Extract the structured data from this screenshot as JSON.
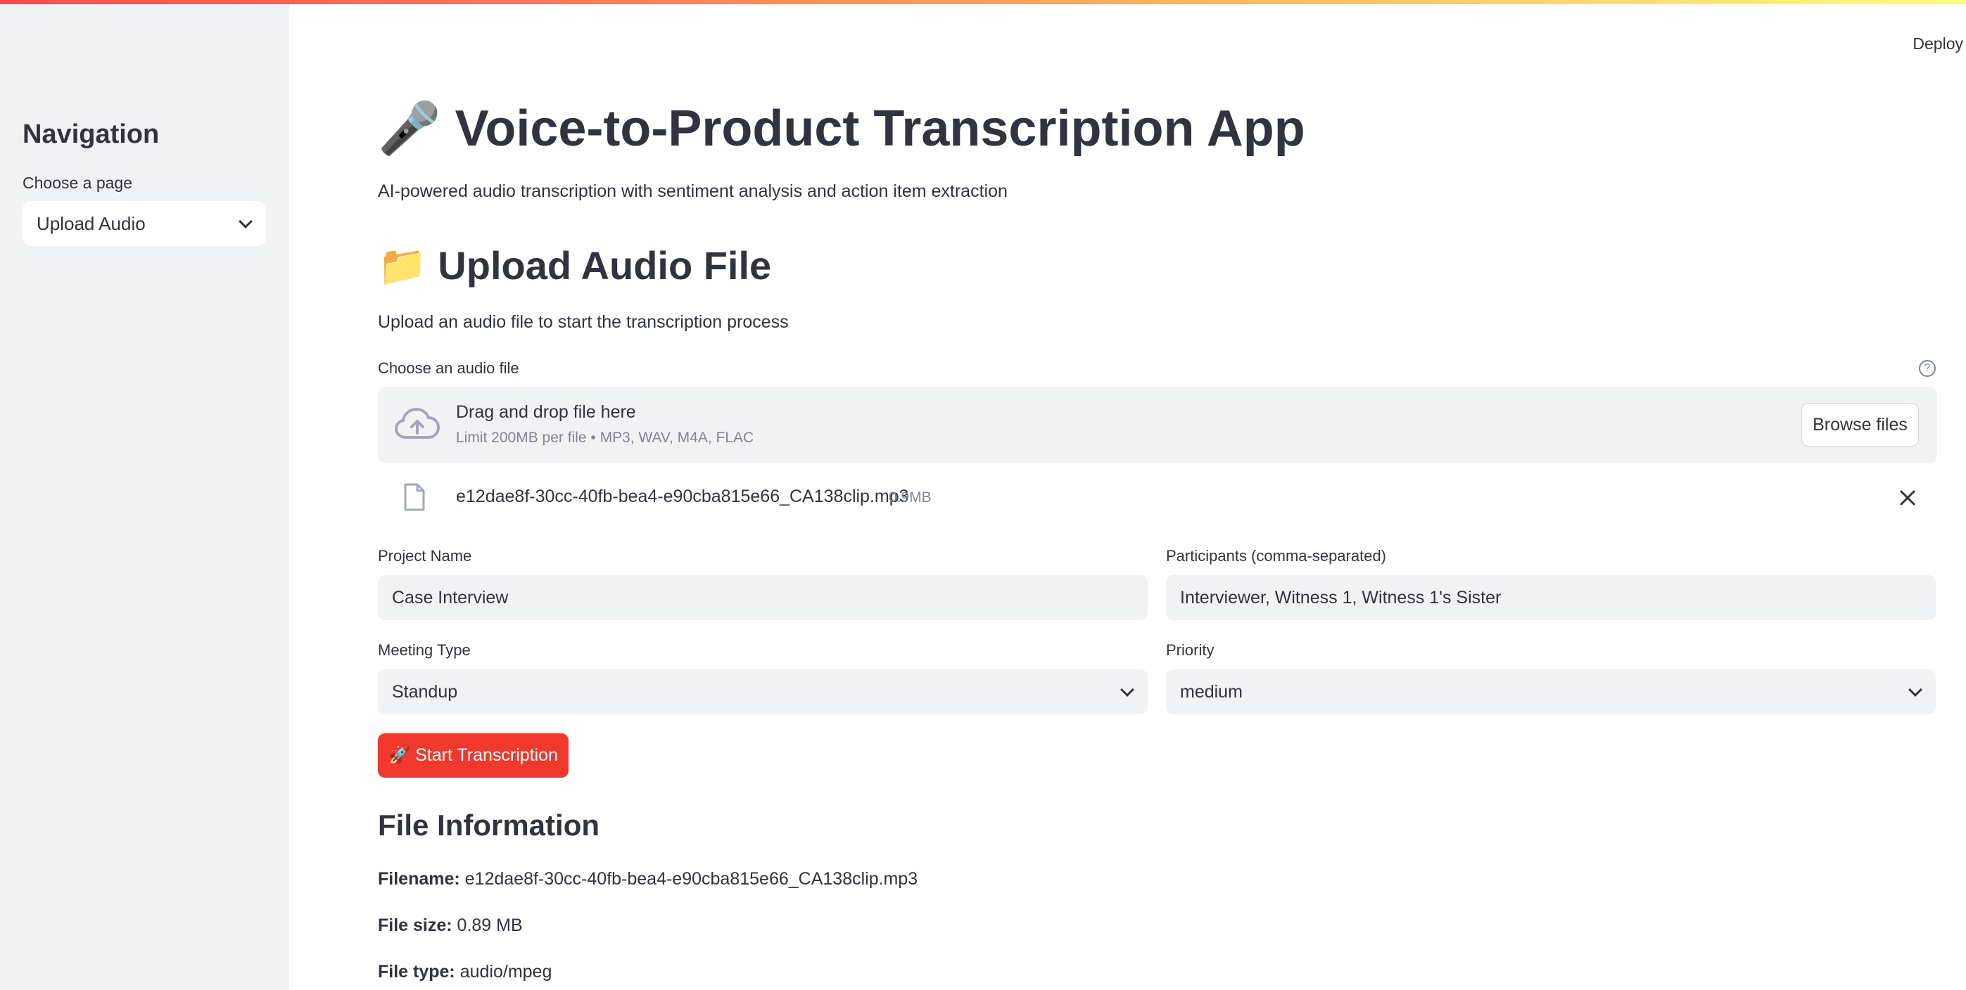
{
  "header": {
    "deploy_label": "Deploy"
  },
  "sidebar": {
    "title": "Navigation",
    "page_select_label": "Choose a page",
    "page_select_value": "Upload Audio"
  },
  "main": {
    "title_icon": "🎤",
    "title": "Voice-to-Product Transcription App",
    "subtitle": "AI-powered audio transcription with sentiment analysis and action item extraction",
    "upload_icon": "📁",
    "upload_heading": "Upload Audio File",
    "upload_description": "Upload an audio file to start the transcription process",
    "uploader": {
      "label": "Choose an audio file",
      "help_icon": "question-circle-icon",
      "drop_title": "Drag and drop file here",
      "limit_text": "Limit 200MB per file • MP3, WAV, M4A, FLAC",
      "browse_label": "Browse files"
    },
    "uploaded_file": {
      "name": "e12dae8f-30cc-40fb-bea4-e90cba815e66_CA138clip.mp3",
      "size": "0.9MB"
    },
    "form": {
      "project_name_label": "Project Name",
      "project_name_value": "Case Interview",
      "participants_label": "Participants (comma-separated)",
      "participants_value": "Interviewer, Witness 1, Witness 1's Sister",
      "meeting_type_label": "Meeting Type",
      "meeting_type_value": "Standup",
      "priority_label": "Priority",
      "priority_value": "medium"
    },
    "start_button_label": "🚀 Start Transcription",
    "file_info": {
      "heading": "File Information",
      "filename_label": "Filename:",
      "filename_value": "e12dae8f-30cc-40fb-bea4-e90cba815e66_CA138clip.mp3",
      "filesize_label": "File size:",
      "filesize_value": "0.89 MB",
      "filetype_label": "File type:",
      "filetype_value": "audio/mpeg"
    }
  },
  "colors": {
    "accent": "#f0382c",
    "sidebar_bg": "#f0f2f6",
    "text": "#31333f",
    "muted": "#808495"
  }
}
